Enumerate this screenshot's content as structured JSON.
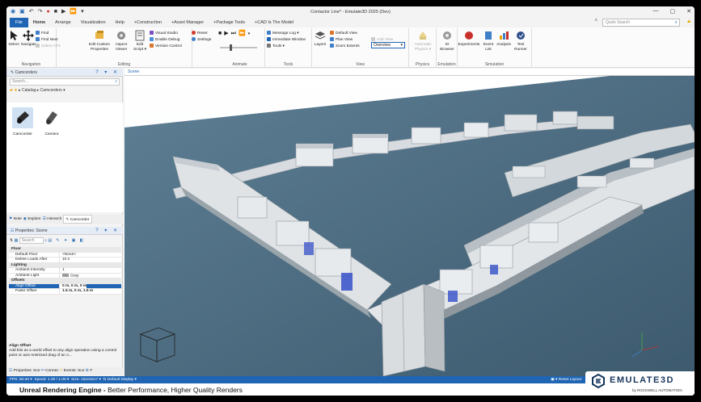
{
  "window": {
    "title": "Contactor Line* - Emulate3D 2025 (Dev)",
    "qat_icons": [
      "app-logo-icon",
      "save-icon",
      "undo-icon",
      "redo-icon",
      "record-icon",
      "stop-icon",
      "play-icon",
      "fast-forward-icon",
      "dropdown-icon"
    ],
    "controls": {
      "minimize": "—",
      "maximize": "▢",
      "close": "✕"
    }
  },
  "ribbon_tabs": [
    "File",
    "Home",
    "Arrange",
    "Visualization",
    "Help",
    "+Construction",
    "+Asset Manager",
    "+Package Tools",
    "+CAD Is The Model"
  ],
  "ribbon_active_tab": "Home",
  "quick_search": {
    "placeholder": "Quick Search"
  },
  "ribbon": {
    "navigation": {
      "label": "Navigation",
      "select": "Select",
      "navigate": "Navigate",
      "find": "Find",
      "find_next": "Find Next",
      "select_all": "Select All ▾"
    },
    "editing": {
      "label": "Editing",
      "edit_custom_properties": "Edit Custom Properties",
      "aspect_viewer": "Aspect Viewer",
      "edit_script": "Edit Script ▾",
      "visual_studio": "Visual Studio",
      "enable_debug": "Enable Debug",
      "version_control": "Version Control",
      "reset": "Reset",
      "settings": "Settings"
    },
    "animate": {
      "label": "Animate"
    },
    "tools": {
      "label": "Tools",
      "message_log": "Message Log ▾",
      "immediate_window": "Immediate Window",
      "tools": "Tools ▾"
    },
    "view": {
      "label": "View",
      "layers": "Layers",
      "default_view": "Default View",
      "plan_view": "Plan View",
      "zoom_extents": "Zoom Extents",
      "overview": "Overview",
      "add_view": "Add View",
      "remove_view": "Remove View"
    },
    "physics": {
      "label": "Physics",
      "automatic_physics": "Automatic Physics ▾"
    },
    "emulation": {
      "label": "Emulation",
      "io_browser": "IO Browser"
    },
    "simulation": {
      "label": "Simulation",
      "experiments": "Experiments",
      "event_list": "Event List",
      "analysis": "Analysis",
      "test_runner": "Test Runner"
    }
  },
  "catalog_panel": {
    "title": "Camcorders",
    "search_placeholder": "Search...",
    "breadcrumb": "▸ Catalog ▸ Camcorders ▾",
    "items": [
      {
        "label": "Camcorder"
      },
      {
        "label": "Camera"
      }
    ],
    "tabs": [
      "Note",
      "Explore",
      "Hierarch",
      "Camcorder"
    ]
  },
  "properties_panel": {
    "title": "Properties: Scene",
    "search_placeholder": "Search",
    "rows": [
      {
        "type": "cat",
        "key": "Floor",
        "value": ""
      },
      {
        "type": "row",
        "key": "Default Floor",
        "value": "<None>"
      },
      {
        "type": "row",
        "key": "Delete Loads After",
        "value": "10 s"
      },
      {
        "type": "cat",
        "key": "Lighting",
        "value": ""
      },
      {
        "type": "row",
        "key": "Ambient Intensity",
        "value": "1"
      },
      {
        "type": "row",
        "key": "Ambient Light",
        "value": "Gray"
      },
      {
        "type": "cat",
        "key": "Offsets",
        "value": ""
      },
      {
        "type": "sel",
        "key": "Align Offset",
        "value": "0 m, 0 m, 0 m"
      },
      {
        "type": "row",
        "key": "Paste Offset",
        "value": "1.5 m, 0 m, 1.5 m"
      }
    ],
    "description_title": "Align Offset",
    "description_text": "Add this as a world offset to any align operation using a control point or axis restricted drag of an o...",
    "bottom_tabs": [
      "Properties: Sce",
      "Connec",
      "Events: Sce",
      "F"
    ]
  },
  "scene": {
    "tab": "Scene"
  },
  "status": {
    "fps": "FPS: 50.00 ▾",
    "speed": "Speed: 1.00 / 1.00 ▾",
    "size": "Size: 1610x817 ▾",
    "display": "Default Display ▾",
    "reset_layout": "▾ Reset Layout"
  },
  "caption": {
    "bold": "Unreal Rendering Engine - ",
    "text": "Better Performance, Higher Quality Renders"
  },
  "brand": {
    "name": "EMULATE3D",
    "sub": "by ROCKWELL AUTOMATION"
  }
}
